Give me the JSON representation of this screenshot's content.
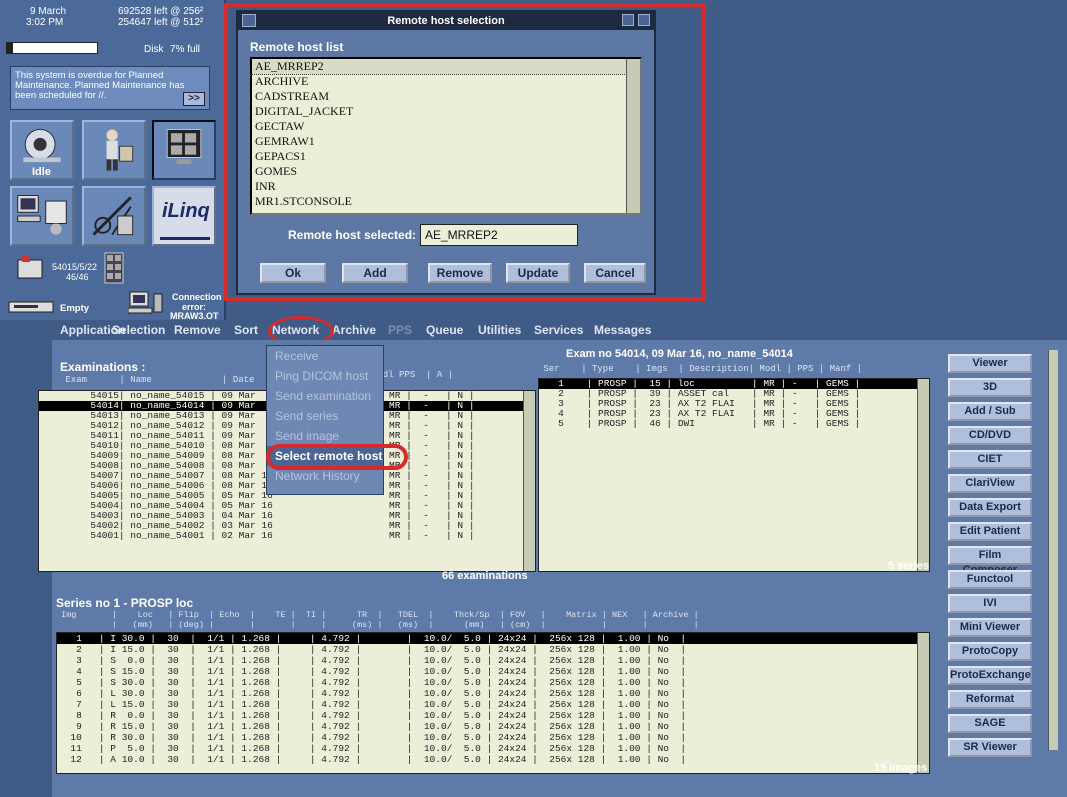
{
  "status": {
    "date": "9 March",
    "time": "3:02 PM",
    "images_left_256": "692528 left @ 256²",
    "images_left_512": "254647 left @ 512²",
    "disk_label": "Disk",
    "disk_percent": "7% full",
    "disk_fraction": 0.07,
    "notice_text": "This system is overdue for Planned Maintenance. Planned Maintenance has been scheduled for //.",
    "notice_button": ">>",
    "scanner_state": "Idle",
    "brand_tile": "iLinq",
    "exam_id": "54015/5/22",
    "exam_sub": "46/46",
    "drive_status": "Empty",
    "connection_label": "Connection",
    "connection_error": "error:",
    "connection_host": "MRAW3.OT"
  },
  "dialog": {
    "title": "Remote host selection",
    "list_label": "Remote host list",
    "hosts": [
      "AE_MRREP2",
      "ARCHIVE",
      "CADSTREAM",
      "DIGITAL_JACKET",
      "GECTAW",
      "GEMRAW1",
      "GEPACS1",
      "GOMES",
      "INR",
      "MR1.STCONSOLE"
    ],
    "selected_label": "Remote host selected:",
    "selected_value": "AE_MRREP2",
    "buttons": {
      "ok": "Ok",
      "add": "Add",
      "remove": "Remove",
      "update": "Update",
      "cancel": "Cancel"
    }
  },
  "menubar": [
    "Application",
    "Selection",
    "Remove",
    "Sort",
    "Network",
    "Archive",
    "PPS",
    "Queue",
    "Utilities",
    "Services",
    "Messages"
  ],
  "network_menu": {
    "items": [
      "Receive",
      "Ping DICOM host",
      "Send examination",
      "Send series",
      "Send image",
      "Select remote host",
      "Network History"
    ],
    "active": "Select remote host"
  },
  "examinations": {
    "title": "Examinations :",
    "header": " Exam      | Name             | Date",
    "header_right": "Modl PPS  | A |",
    "rows": [
      "  54015| no_name_54015 | 09 Mar",
      "  54014| no_name_54014 | 09 Mar",
      "  54013| no_name_54013 | 09 Mar",
      "  54012| no_name_54012 | 09 Mar",
      "  54011| no_name_54011 | 09 Mar",
      "  54010| no_name_54010 | 08 Mar",
      "  54009| no_name_54009 | 08 Mar",
      "  54008| no_name_54008 | 08 Mar",
      "  54007| no_name_54007 | 08 Mar 16",
      "  54006| no_name_54006 | 08 Mar 16",
      "  54005| no_name_54005 | 05 Mar 16",
      "  54004| no_name_54004 | 05 Mar 16",
      "  54003| no_name_54003 | 04 Mar 16",
      "  54002| no_name_54002 | 03 Mar 16",
      "  54001| no_name_54001 | 02 Mar 16"
    ],
    "rows_right": [
      "MR |  -   | N |",
      "MR |  -   | N |",
      "MR |  -   | N |",
      "MR |  -   | N |",
      "MR |  -   | N |",
      "MR |  -   | N |",
      "MR |  -   | N |",
      "MR |  -   | N |",
      "MR |  -   | N |",
      "MR |  -   | N |",
      "MR |  -   | N |",
      "MR |  -   | N |",
      "MR |  -   | N |",
      "MR |  -   | N |",
      "MR |  -   | N |"
    ],
    "selected_index": 1,
    "count": "66 examinations"
  },
  "exam_series": {
    "title": "Exam no 54014, 09 Mar 16, no_name_54014",
    "header": " Ser    | Type    | Imgs  | Description| Modl | PPS | Manf |",
    "rows": [
      "   1    | PROSP |  15 | loc          | MR | -   | GEMS |",
      "   2    | PROSP |  39 | ASSET cal    | MR | -   | GEMS |",
      "   3    | PROSP |  23 | AX T2 FLAI   | MR | -   | GEMS |",
      "   4    | PROSP |  23 | AX T2 FLAI   | MR | -   | GEMS |",
      "   5    | PROSP |  46 | DWI          | MR | -   | GEMS |"
    ],
    "selected_index": 0,
    "count": "5 series"
  },
  "images": {
    "title": "Series no 1 - PROSP  loc",
    "header": " Img       |    Loc   | Flip  | Echo  |    TE |  TI |      TR  |   TDEL  |    Thck/Sp  | FOV   |    Matrix | NEX   | Archive |",
    "subheader": "           |   (mm)   | (deg) |       |       |     |     (ms) |   (ms)  |      (mm)   | (cm)  |           |       |         |",
    "rows": [
      "   1   | I 30.0 |  30  |  1/1 | 1.268 |     | 4.792 |        |  10.0/  5.0 | 24x24 |  256x 128 |  1.00 | No  |",
      "   2   | I 15.0 |  30  |  1/1 | 1.268 |     | 4.792 |        |  10.0/  5.0 | 24x24 |  256x 128 |  1.00 | No  |",
      "   3   | S  0.0 |  30  |  1/1 | 1.268 |     | 4.792 |        |  10.0/  5.0 | 24x24 |  256x 128 |  1.00 | No  |",
      "   4   | S 15.0 |  30  |  1/1 | 1.268 |     | 4.792 |        |  10.0/  5.0 | 24x24 |  256x 128 |  1.00 | No  |",
      "   5   | S 30.0 |  30  |  1/1 | 1.268 |     | 4.792 |        |  10.0/  5.0 | 24x24 |  256x 128 |  1.00 | No  |",
      "   6   | L 30.0 |  30  |  1/1 | 1.268 |     | 4.792 |        |  10.0/  5.0 | 24x24 |  256x 128 |  1.00 | No  |",
      "   7   | L 15.0 |  30  |  1/1 | 1.268 |     | 4.792 |        |  10.0/  5.0 | 24x24 |  256x 128 |  1.00 | No  |",
      "   8   | R  0.0 |  30  |  1/1 | 1.268 |     | 4.792 |        |  10.0/  5.0 | 24x24 |  256x 128 |  1.00 | No  |",
      "   9   | R 15.0 |  30  |  1/1 | 1.268 |     | 4.792 |        |  10.0/  5.0 | 24x24 |  256x 128 |  1.00 | No  |",
      "  10   | R 30.0 |  30  |  1/1 | 1.268 |     | 4.792 |        |  10.0/  5.0 | 24x24 |  256x 128 |  1.00 | No  |",
      "  11   | P  5.0 |  30  |  1/1 | 1.268 |     | 4.792 |        |  10.0/  5.0 | 24x24 |  256x 128 |  1.00 | No  |",
      "  12   | A 10.0 |  30  |  1/1 | 1.268 |     | 4.792 |        |  10.0/  5.0 | 24x24 |  256x 128 |  1.00 | No  |"
    ],
    "selected_index": 0,
    "count": "15 images"
  },
  "side_buttons": [
    "Viewer",
    "3D",
    "Add / Sub",
    "CD/DVD",
    "CIET",
    "ClariView",
    "Data Export",
    "Edit Patient",
    "Film Composer",
    "Functool",
    "IVI",
    "Mini Viewer",
    "ProtoCopy",
    "ProtoExchange",
    "Reformat",
    "SAGE",
    "SR Viewer"
  ],
  "colors": {
    "highlight": "#d72a2a",
    "desktop": "#3f5b86",
    "panel": "#5e7aa9",
    "list_bg": "#eceed8"
  }
}
